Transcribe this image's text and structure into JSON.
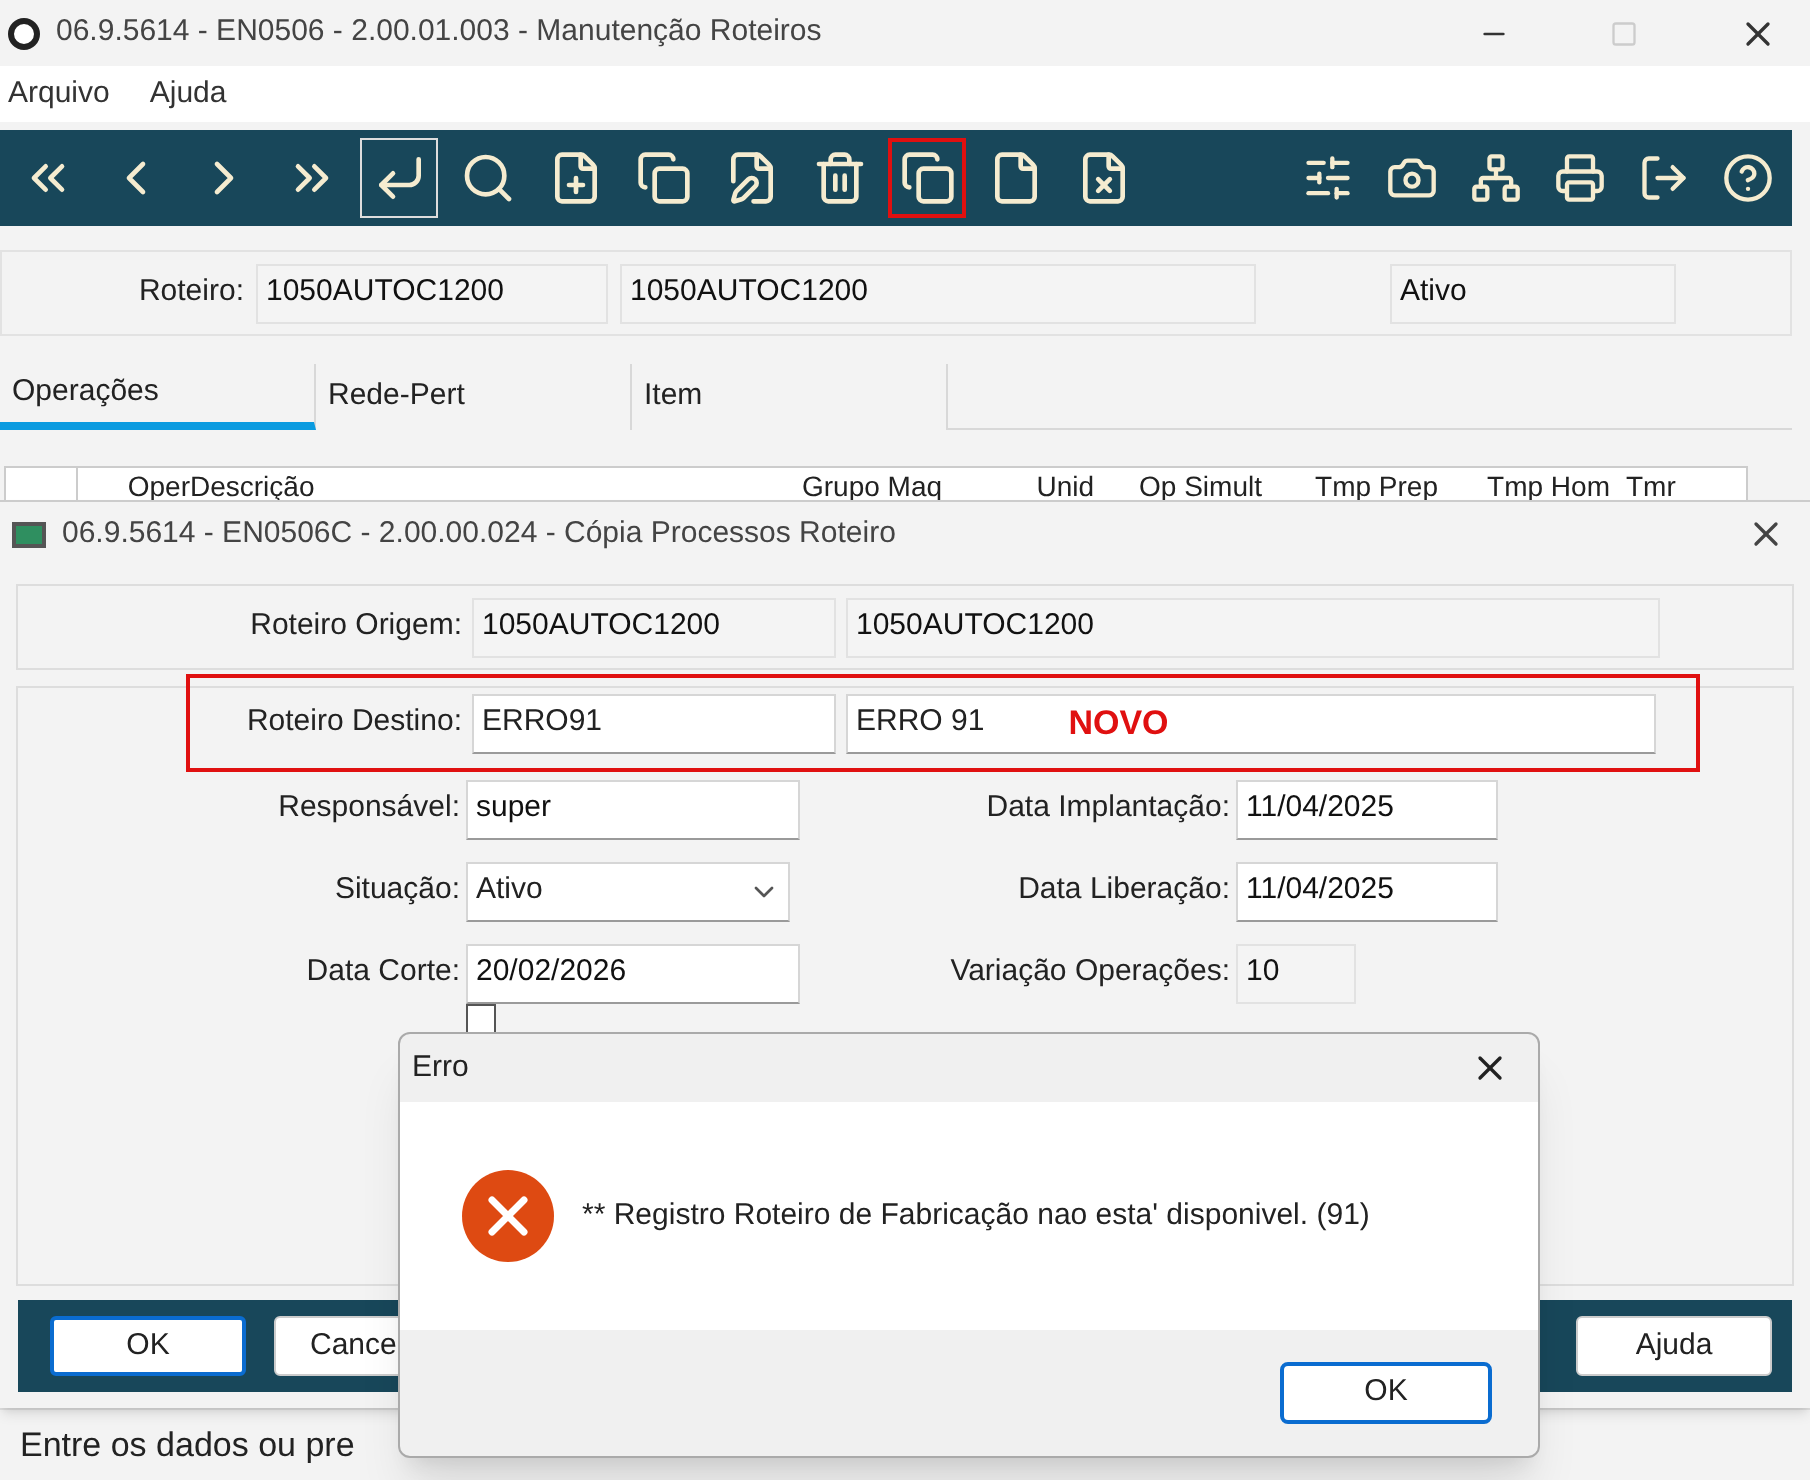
{
  "main_window": {
    "title": "06.9.5614 - EN0506 - 2.00.01.003 - Manutenção Roteiros",
    "menu": [
      "Arquivo",
      "Ajuda"
    ],
    "toolbar_left": [
      {
        "selected": false,
        "highlighted": false
      },
      {
        "selected": false,
        "highlighted": false
      },
      {
        "selected": false,
        "highlighted": false
      },
      {
        "selected": false,
        "highlighted": false
      },
      {
        "selected": true,
        "highlighted": false
      },
      {
        "selected": false,
        "highlighted": false
      },
      {
        "selected": false,
        "highlighted": false
      },
      {
        "selected": false,
        "highlighted": false
      },
      {
        "selected": false,
        "highlighted": false
      },
      {
        "selected": false,
        "highlighted": false
      },
      {
        "selected": false,
        "highlighted": true
      },
      {
        "selected": false,
        "highlighted": false
      },
      {
        "selected": false,
        "highlighted": false
      }
    ],
    "toolbar_right": [
      {
        "selected": false
      },
      {
        "selected": false
      },
      {
        "selected": false
      },
      {
        "selected": false
      },
      {
        "selected": false
      },
      {
        "selected": false
      }
    ],
    "header": {
      "label": "Roteiro:",
      "code": "1050AUTOC1200",
      "description": "1050AUTOC1200",
      "status": "Ativo"
    },
    "tabs": [
      {
        "label": "Operações",
        "selected": true
      },
      {
        "label": "Rede-Pert",
        "selected": false
      },
      {
        "label": "Item",
        "selected": false
      }
    ],
    "table": {
      "columns": [
        "Oper",
        "Descrição",
        "Grupo Maq",
        "Unid",
        "Op Simult",
        "Tmp Prep",
        "Tmp Hom",
        "Tmr"
      ]
    },
    "status_bar": "Entre os dados ou pre"
  },
  "copy_dialog": {
    "title": "06.9.5614 - EN0506C - 2.00.00.024 - Cópia Processos Roteiro",
    "origem": {
      "label": "Roteiro Origem:",
      "code": "1050AUTOC1200",
      "description": "1050AUTOC1200"
    },
    "destino": {
      "label": "Roteiro Destino:",
      "code": "ERRO91",
      "description": "ERRO 91",
      "note": "NOVO",
      "highlighted": true
    },
    "fields_left": [
      {
        "kind": "text",
        "label": "Responsável:",
        "value": "super"
      },
      {
        "kind": "select",
        "label": "Situação:",
        "value": "Ativo"
      },
      {
        "kind": "text",
        "label": "Data Corte:",
        "value": "20/02/2026"
      }
    ],
    "fields_right": [
      {
        "kind": "text",
        "label": "Data Implantação:",
        "value": "11/04/2025"
      },
      {
        "kind": "text",
        "label": "Data Liberação:",
        "value": "11/04/2025"
      },
      {
        "kind": "readonly",
        "label": "Variação Operações:",
        "value": "10"
      }
    ],
    "checkbox": {
      "checked": false
    },
    "buttons": [
      "OK",
      "Cance"
    ],
    "help_button": "Ajuda"
  },
  "error_dialog": {
    "title": "Erro",
    "message": "** Registro Roteiro de Fabricação nao esta' disponivel. (91)",
    "button": "OK"
  }
}
